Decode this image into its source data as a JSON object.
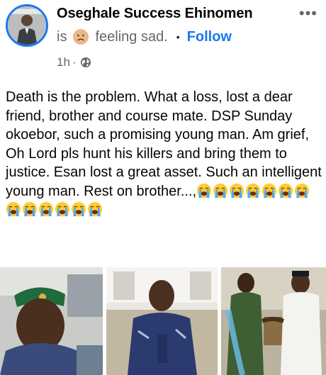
{
  "post": {
    "author": "Oseghale Success Ehinomen",
    "feeling_prefix": "is",
    "feeling_text": "feeling sad.",
    "follow_label": "Follow",
    "timestamp": "1h",
    "meta_separator": "·",
    "body": "Death is the problem. What a loss, lost a dear friend, brother and course mate. DSP Sunday okoebor, such a promising young man. Am grief, Oh Lord pls hunt his killers and bring them to justice. Esan lost a great asset. Such an intelligent young man. Rest on brother...,",
    "crying_emoji_count": 13
  },
  "icons": {
    "more": "more-options-icon",
    "globe": "globe-icon",
    "feeling_emoji": "sad-face-emoji-icon",
    "crying_emoji": "loudly-crying-emoji-icon"
  },
  "colors": {
    "accent": "#1877f2",
    "secondary_text": "#65676b",
    "primary_text": "#050505"
  }
}
